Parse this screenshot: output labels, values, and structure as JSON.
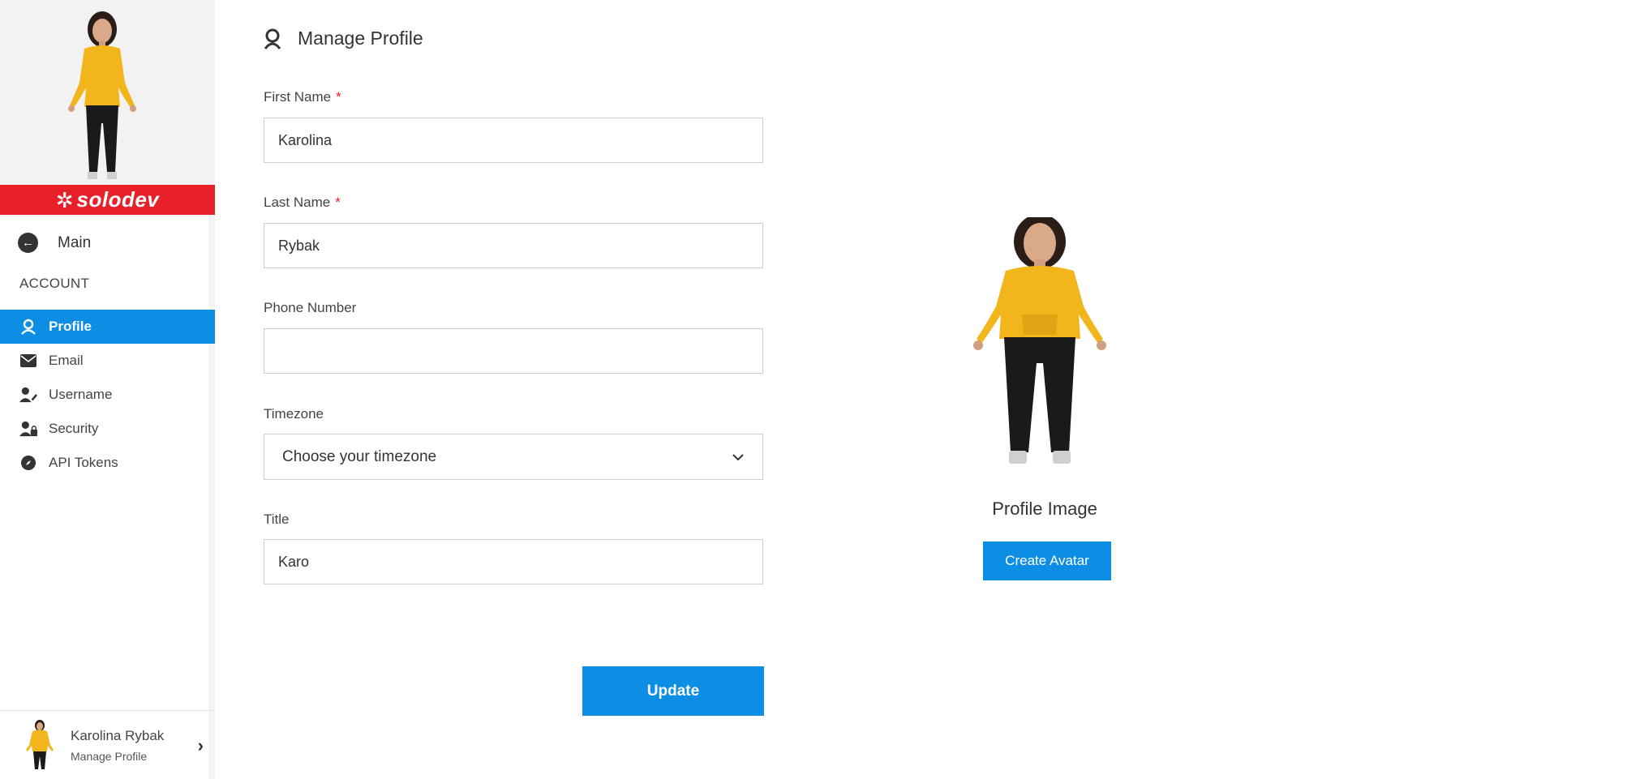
{
  "brand": {
    "name": "solodev",
    "mark": "✲"
  },
  "sidebar": {
    "main_label": "Main",
    "section_label": "ACCOUNT",
    "items": [
      {
        "label": "Profile",
        "icon": "user-circle-icon",
        "active": true
      },
      {
        "label": "Email",
        "icon": "envelope-icon",
        "active": false
      },
      {
        "label": "Username",
        "icon": "user-edit-icon",
        "active": false
      },
      {
        "label": "Security",
        "icon": "user-lock-icon",
        "active": false
      },
      {
        "label": "API Tokens",
        "icon": "compass-icon",
        "active": false
      }
    ],
    "footer": {
      "name": "Karolina Rybak",
      "sub": "Manage Profile"
    }
  },
  "page": {
    "title": "Manage Profile"
  },
  "form": {
    "first_name": {
      "label": "First Name",
      "required_mark": "*",
      "value": "Karolina"
    },
    "last_name": {
      "label": "Last Name",
      "required_mark": "*",
      "value": "Rybak"
    },
    "phone": {
      "label": "Phone Number",
      "value": ""
    },
    "timezone": {
      "label": "Timezone",
      "selected": "Choose your timezone"
    },
    "title": {
      "label": "Title",
      "value": "Karo"
    },
    "update_label": "Update"
  },
  "profile_image": {
    "label": "Profile Image",
    "button_label": "Create Avatar"
  },
  "colors": {
    "accent": "#0b8ee3",
    "brand_red": "#e8202a",
    "hoodie": "#f2b51c",
    "pants": "#1a1a1a"
  }
}
